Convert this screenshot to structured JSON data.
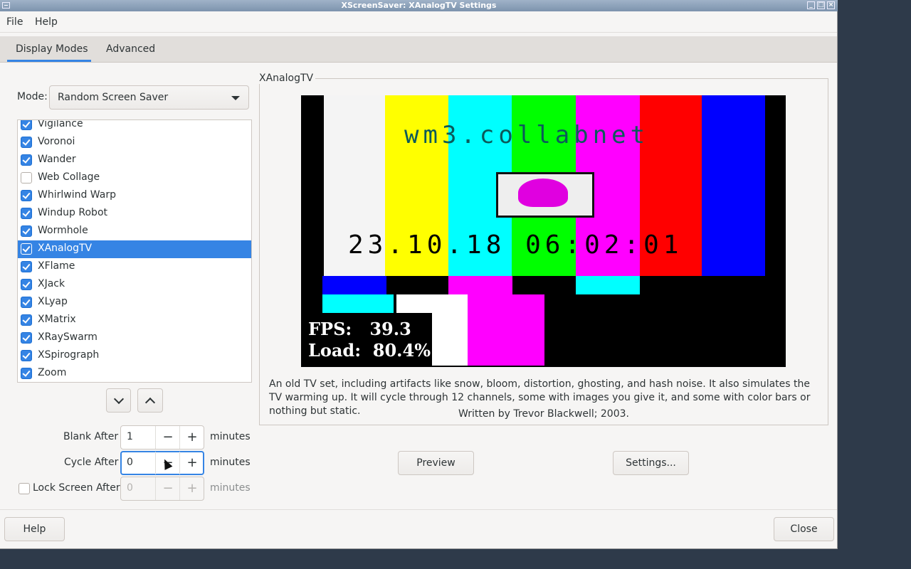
{
  "window": {
    "title": "XScreenSaver: XAnalogTV Settings"
  },
  "menubar": {
    "file": "File",
    "help": "Help"
  },
  "tabs": [
    {
      "label": "Display Modes",
      "active": true
    },
    {
      "label": "Advanced",
      "active": false
    }
  ],
  "mode": {
    "label": "Mode:",
    "value": "Random Screen Saver"
  },
  "savers": [
    {
      "name": "Vigilance",
      "checked": true
    },
    {
      "name": "Voronoi",
      "checked": true
    },
    {
      "name": "Wander",
      "checked": true
    },
    {
      "name": "Web Collage",
      "checked": false
    },
    {
      "name": "Whirlwind Warp",
      "checked": true
    },
    {
      "name": "Windup Robot",
      "checked": true
    },
    {
      "name": "Wormhole",
      "checked": true
    },
    {
      "name": "XAnalogTV",
      "checked": true,
      "selected": true
    },
    {
      "name": "XFlame",
      "checked": true
    },
    {
      "name": "XJack",
      "checked": true
    },
    {
      "name": "XLyap",
      "checked": true
    },
    {
      "name": "XMatrix",
      "checked": true
    },
    {
      "name": "XRaySwarm",
      "checked": true
    },
    {
      "name": "XSpirograph",
      "checked": true
    },
    {
      "name": "Zoom",
      "checked": true
    }
  ],
  "timing": {
    "blank_label": "Blank After",
    "blank_value": "1",
    "cycle_label": "Cycle After",
    "cycle_value": "0",
    "lock_label": "Lock Screen After",
    "lock_value": "0",
    "minus": "−",
    "plus": "+",
    "unit": "minutes"
  },
  "preview": {
    "frame_title": "XAnalogTV",
    "tv_banner": "wm3.collabnet",
    "tv_clock": "23.10.18 06:02:01",
    "fps_line": "FPS:   39.3",
    "load_line": "Load:  80.4%",
    "description": "An old TV set, including artifacts like snow, bloom, distortion, ghosting, and hash noise. It also simulates the TV warming up. It will cycle through 12 channels, some with images you give it, and some with color bars or nothing but static.",
    "author": "Written by Trevor Blackwell; 2003.",
    "bar_colors": [
      "#f4f4f4",
      "#ffff00",
      "#00ffff",
      "#00ff00",
      "#ff00ff",
      "#ff0000",
      "#0000ff"
    ]
  },
  "buttons": {
    "preview": "Preview",
    "settings": "Settings...",
    "help": "Help",
    "close": "Close"
  }
}
